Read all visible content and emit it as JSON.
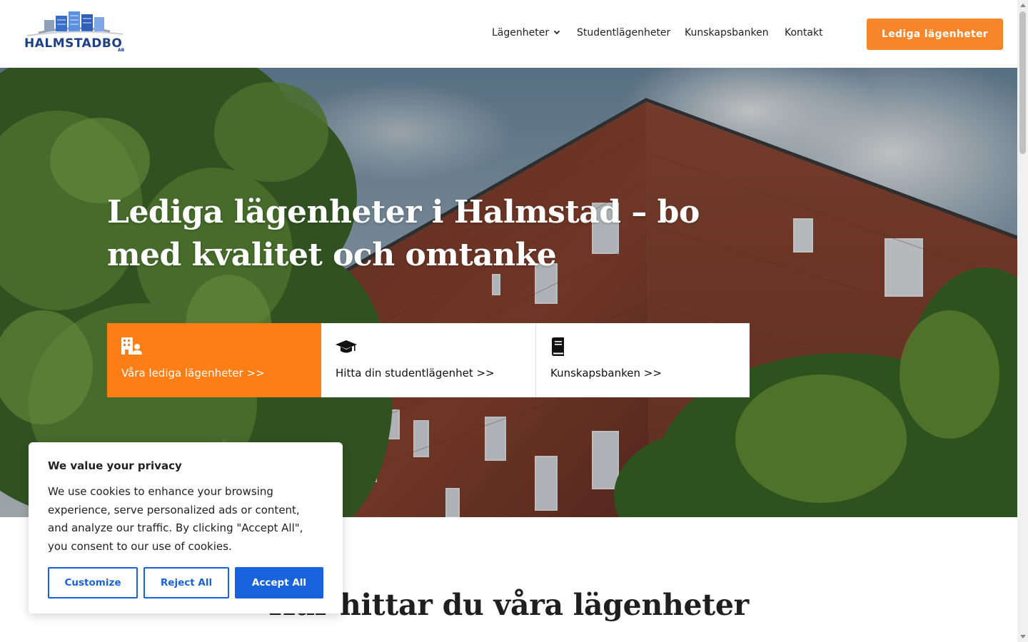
{
  "header": {
    "logo": {
      "name": "HALMSTADBO",
      "suffix": "AB"
    },
    "nav": [
      {
        "label": "Lägenheter",
        "has_dropdown": true
      },
      {
        "label": "Studentlägenheter"
      },
      {
        "label": "Kunskapsbanken"
      },
      {
        "label": "Kontakt"
      }
    ],
    "cta_label": "Lediga lägenheter"
  },
  "hero": {
    "title": "Lediga lägenheter i Halmstad – bo med kvalitet och omtanke",
    "cards": [
      {
        "label": "Våra lediga lägenheter >>",
        "icon": "building-user-icon"
      },
      {
        "label": "Hitta din studentlägenhet >>",
        "icon": "graduation-cap-icon"
      },
      {
        "label": "Kunskapsbanken >>",
        "icon": "book-icon"
      }
    ]
  },
  "section": {
    "title": "Här hittar du våra lägenheter"
  },
  "cookie": {
    "title": "We value your privacy",
    "text": "We use cookies to enhance your browsing experience, serve personalized ads or content, and analyze our traffic. By clicking \"Accept All\", you consent to our use of cookies.",
    "customize": "Customize",
    "reject": "Reject All",
    "accept": "Accept All"
  },
  "colors": {
    "accent_orange": "#f7862a",
    "card_orange": "#fd7e14",
    "cookie_blue": "#1863dc",
    "logo_blue": "#1f3f86"
  }
}
